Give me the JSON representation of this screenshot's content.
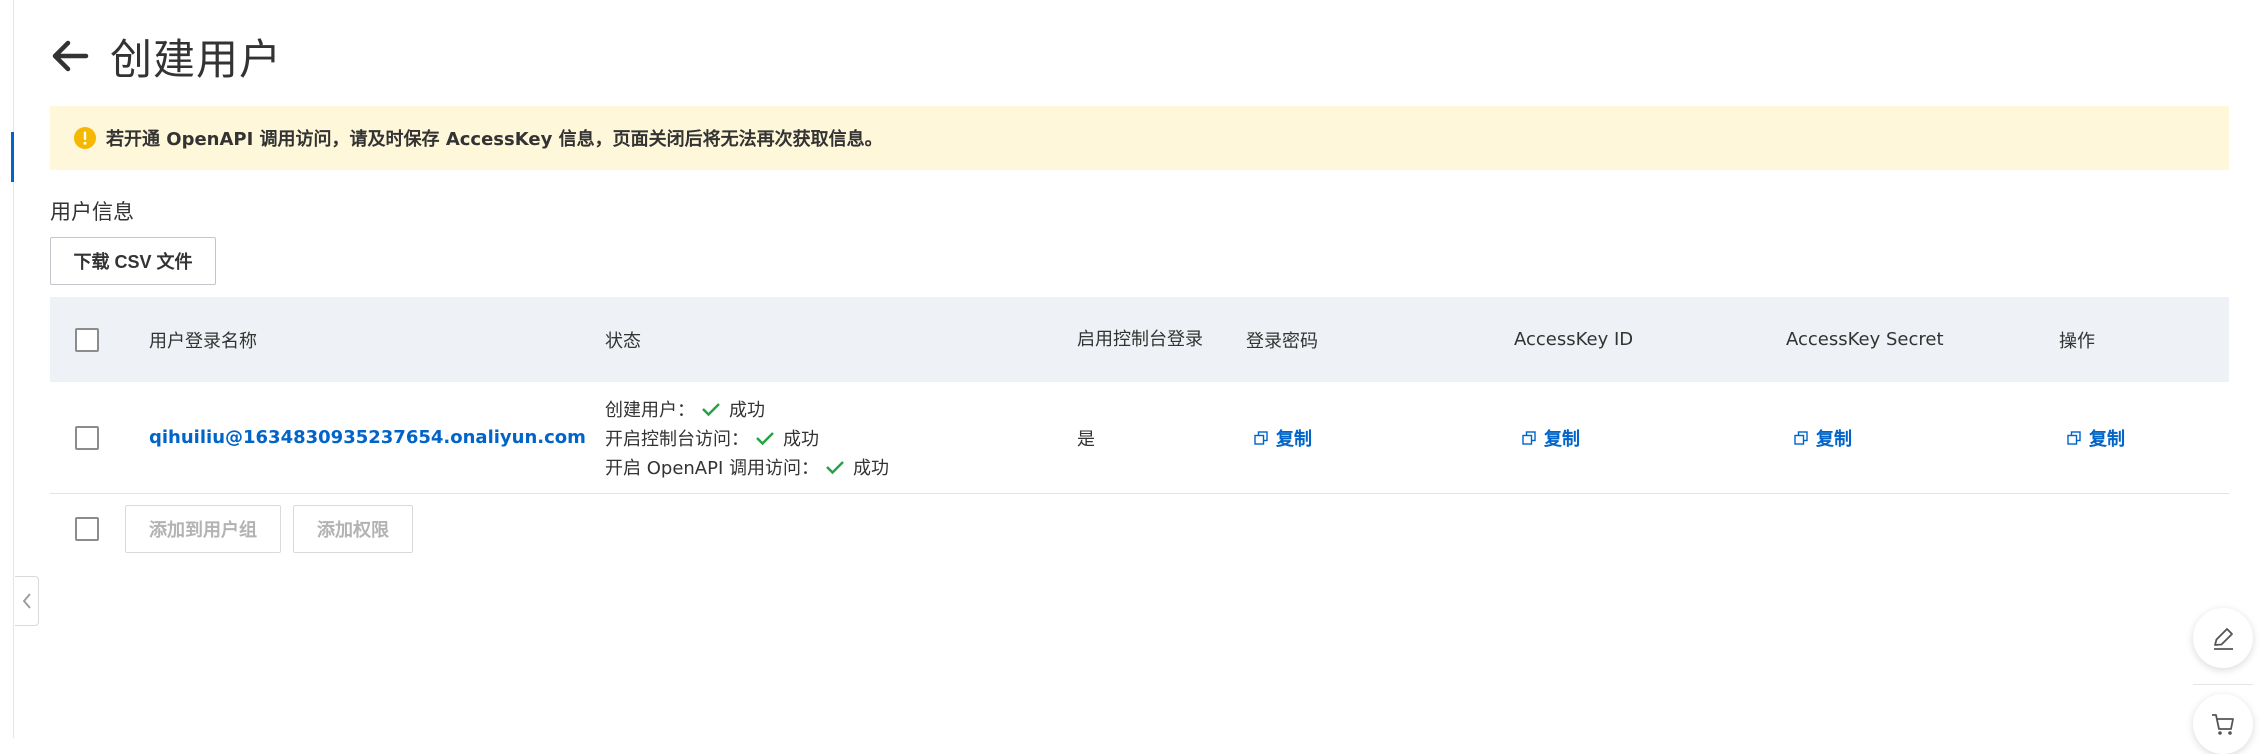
{
  "header": {
    "title": "创建用户"
  },
  "alert": {
    "text": "若开通 OpenAPI 调用访问，请及时保存 AccessKey 信息，页面关闭后将无法再次获取信息。"
  },
  "section": {
    "label": "用户信息",
    "download_csv_label": "下载 CSV 文件"
  },
  "table": {
    "headers": {
      "name": "用户登录名称",
      "status": "状态",
      "console_login": "启用控制台登录",
      "password": "登录密码",
      "ak_id": "AccessKey ID",
      "ak_secret": "AccessKey Secret",
      "actions": "操作"
    },
    "rows": [
      {
        "name": "qihuiliu@1634830935237654.onaliyun.com",
        "status": [
          {
            "label": "创建用户：",
            "result": "成功"
          },
          {
            "label": "开启控制台访问：",
            "result": "成功"
          },
          {
            "label": "开启 OpenAPI 调用访问：",
            "result": "成功"
          }
        ],
        "console_login": "是",
        "password_action": "复制",
        "ak_id_action": "复制",
        "ak_secret_action": "复制",
        "row_action": "复制"
      }
    ]
  },
  "footer": {
    "add_to_group_label": "添加到用户组",
    "add_permission_label": "添加权限"
  },
  "colors": {
    "accent": "#0064c8",
    "success": "#23a344",
    "warning_bg": "#fff7d9",
    "warning_icon": "#f5b700"
  }
}
